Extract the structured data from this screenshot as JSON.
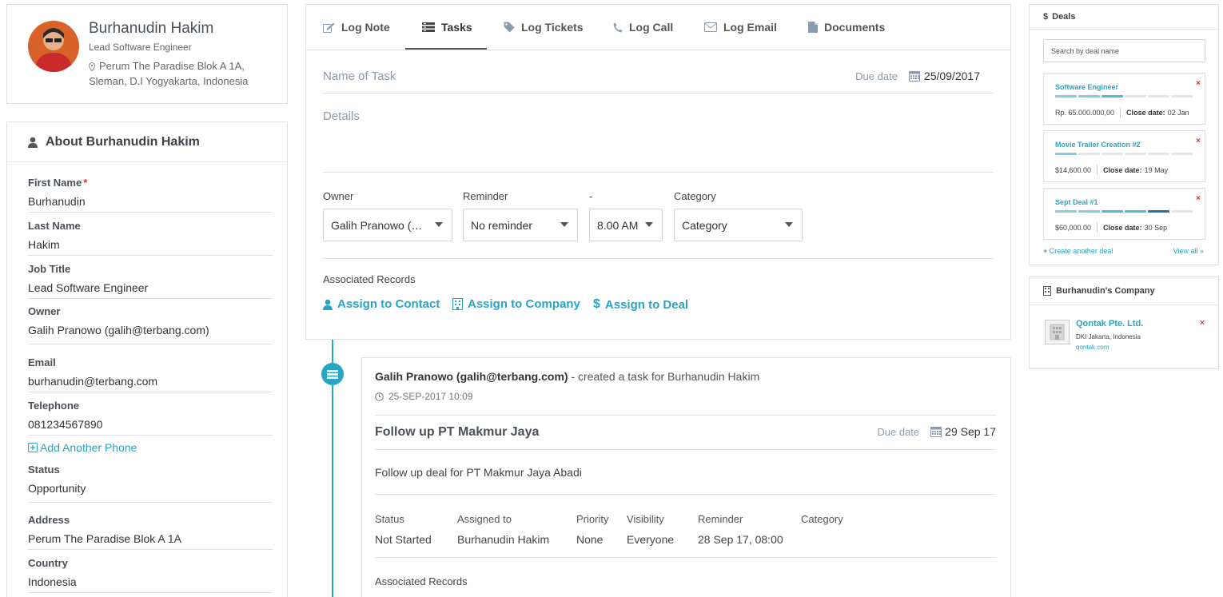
{
  "profile": {
    "name": "Burhanudin Hakim",
    "title": "Lead Software Engineer",
    "address_line1": "Perum The Paradise Blok A 1A,",
    "address_line2": "Sleman, D.I Yogyakarta, Indonesia"
  },
  "about": {
    "header": "About Burhanudin Hakim",
    "fields": [
      {
        "label": "First Name",
        "value": "Burhanudin",
        "required_mark": "*"
      },
      {
        "label": "Last Name",
        "value": "Hakim"
      },
      {
        "label": "Job Title",
        "value": "Lead Software Engineer"
      },
      {
        "label": "Owner",
        "value": "Galih Pranowo (galih@terbang.com)"
      },
      {
        "label": "Email",
        "value": "burhanudin@terbang.com"
      },
      {
        "label": "Telephone",
        "value": "081234567890"
      },
      {
        "label": "Status",
        "value": "Opportunity"
      },
      {
        "label": "Address",
        "value": "Perum The Paradise Blok A 1A"
      },
      {
        "label": "Country",
        "value": "Indonesia"
      }
    ],
    "add_phone_label": "Add Another Phone"
  },
  "tabs": [
    {
      "label": "Log Note",
      "icon": "edit-icon"
    },
    {
      "label": "Tasks",
      "icon": "tasks-icon",
      "active": true
    },
    {
      "label": "Log Tickets",
      "icon": "tag-icon"
    },
    {
      "label": "Log Call",
      "icon": "phone-icon"
    },
    {
      "label": "Log Email",
      "icon": "envelope-icon"
    },
    {
      "label": "Documents",
      "icon": "document-icon"
    }
  ],
  "task_form": {
    "name_placeholder": "Name of Task",
    "due_label": "Due date",
    "due_value": "25/09/2017",
    "details_placeholder": "Details",
    "owner_label": "Owner",
    "owner_value": "Galih Pranowo (…",
    "reminder_label": "Reminder",
    "reminder_value": "No reminder",
    "time_label": "-",
    "time_value": "8.00 AM",
    "category_label": "Category",
    "category_value": "Category",
    "associated_label": "Associated Records",
    "assign_contact": "Assign to Contact",
    "assign_company": "Assign to Company",
    "assign_deal": "Assign to Deal"
  },
  "activity": {
    "actor": "Galih Pranowo (galih@terbang.com)",
    "action": " - created a task for Burhanudin Hakim",
    "timestamp": "25-SEP-2017 10:09",
    "task_title": "Follow up PT Makmur Jaya",
    "due_label": "Due date",
    "due_value": "29 Sep 17",
    "description": "Follow up deal for PT Makmur Jaya Abadi",
    "meta": [
      {
        "label": "Status",
        "value": "Not Started"
      },
      {
        "label": "Assigned to",
        "value": "Burhanudin Hakim"
      },
      {
        "label": "Priority",
        "value": "None"
      },
      {
        "label": "Visibility",
        "value": "Everyone"
      },
      {
        "label": "Reminder",
        "value": "28 Sep 17, 08:00"
      },
      {
        "label": "Category",
        "value": ""
      }
    ],
    "associated_label": "Associated Records"
  },
  "deals": {
    "header": "Deals",
    "search_placeholder": "Search by deal name",
    "items": [
      {
        "name": "Software Engineer",
        "amount": "Rp. 65.000.000,00",
        "close_label": "Close date:",
        "close_date": "02 Jan",
        "stage": 3,
        "stages": 6
      },
      {
        "name": "Movie Trailer Creation #2",
        "amount": "$14,600.00",
        "close_label": "Close date:",
        "close_date": "19 May",
        "stage": 1,
        "stages": 6
      },
      {
        "name": "Sept Deal #1",
        "amount": "$60,000.00",
        "close_label": "Close date:",
        "close_date": "30 Sep",
        "stage": 5,
        "stages": 6
      }
    ],
    "remove_glyph": "×",
    "create_label": "Create another deal",
    "view_all_label": "View all »"
  },
  "company": {
    "header": "Burhanudin's Company",
    "name": "Qontak Pte. Ltd.",
    "location": "DKI Jakarta, Indonesia",
    "url": "qontak.com",
    "remove_glyph": "×"
  },
  "colors": {
    "accent": "#29a5c4",
    "danger": "#c0392b",
    "stage_light": "#7fd0e3",
    "stage_mid": "#4fb8d4",
    "stage_dark": "#2a8fb5",
    "stage_darkest": "#2c6ea6",
    "stage_empty": "#e5e8eb"
  }
}
